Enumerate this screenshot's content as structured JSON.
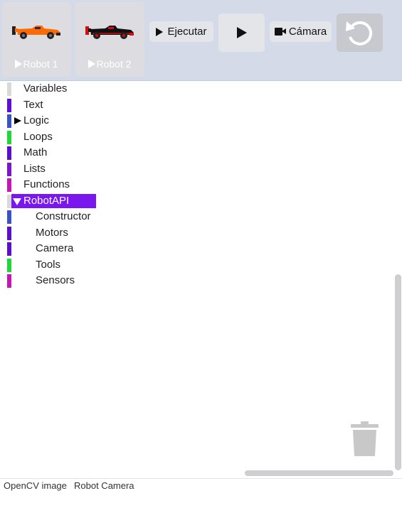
{
  "toolbar": {
    "robots": [
      {
        "label": "Robot 1",
        "car_color": "#ff6a00"
      },
      {
        "label": "Robot 2",
        "car_color": "#111111"
      }
    ],
    "run_label": "Ejecutar",
    "camera_label": "Cámara"
  },
  "sidebar": {
    "items": [
      {
        "label": "Variables",
        "color": "#d9d9d9"
      },
      {
        "label": "Text",
        "color": "#5c10d6"
      },
      {
        "label": "Logic",
        "color": "#3a53c2",
        "expandable": true
      },
      {
        "label": "Loops",
        "color": "#1ed838"
      },
      {
        "label": "Math",
        "color": "#5a10c9"
      },
      {
        "label": "Lists",
        "color": "#7a17c9"
      },
      {
        "label": "Functions",
        "color": "#c316b2"
      },
      {
        "label": "RobotAPI",
        "color": "#d9d9d9",
        "selected": true,
        "expanded": true,
        "children": [
          {
            "label": "Constructor",
            "color": "#3a53c2"
          },
          {
            "label": "Motors",
            "color": "#5a10c9"
          },
          {
            "label": "Camera",
            "color": "#5a10c9"
          },
          {
            "label": "Tools",
            "color": "#1ed838"
          },
          {
            "label": "Sensors",
            "color": "#c316b2"
          }
        ]
      }
    ]
  },
  "footer": {
    "tabs": [
      "OpenCV image",
      "Robot Camera"
    ]
  },
  "colors": {
    "toolbar_bg": "#d5dae8",
    "selected_bg": "#7a17ee"
  }
}
